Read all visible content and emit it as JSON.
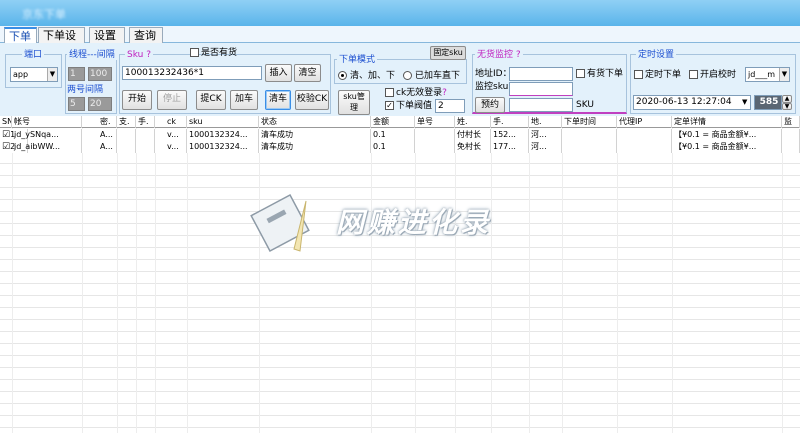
{
  "window": {
    "title": "京东下单"
  },
  "tabs": [
    "下单",
    "下单设置",
    "设置",
    "查询"
  ],
  "port_group": {
    "title": "端口",
    "value": "app"
  },
  "thread_group": {
    "title": "线程---间隔",
    "threads": "1",
    "interval": "100",
    "title2": "两号间隔",
    "v1": "5",
    "v2": "20"
  },
  "sku_group": {
    "title": "Sku",
    "help": "?",
    "in_stock_label": "是否有货",
    "sku_value": "100013232436*1",
    "insert_label": "插入",
    "clear_label": "清空"
  },
  "actions": {
    "start": "开始",
    "stop": "停止",
    "extract_ck": "提CK",
    "add_cart": "加车",
    "clear_cart": "清车",
    "verify_ck": "校验CK",
    "sku_manage": "sku管\n理"
  },
  "mode_group": {
    "title": "下单模式",
    "option1": "清、加、下",
    "option2": "已加车直下",
    "ck_invalid_login": "ck无效登录",
    "help": "?",
    "threshold_label": "下单阀值",
    "threshold_value": "2",
    "lock_sku": "固定sku"
  },
  "stock_group": {
    "title": "无货监控",
    "help": "?",
    "address_label": "地址ID：",
    "address_value": "",
    "stock_order_label": "有货下单",
    "monitor_label": "监控sku",
    "monitor_value": "",
    "reserve_label": "预约",
    "sku_label": "SKU"
  },
  "timer_group": {
    "title": "定时设置",
    "timed_order_label": "定时下单",
    "auto_start_label": "开启校时",
    "time_select_value": "jd___m",
    "datetime_value": "2020-06-13 12:27:04",
    "counter_value": "585"
  },
  "table": {
    "columns": [
      "SN",
      "帐号",
      "密.",
      "支.",
      "手.",
      "ck",
      "sku",
      "状态",
      "金额",
      "单号",
      "姓.",
      "手.",
      "地.",
      "下单时间",
      "代理IP",
      "定单详情",
      "监"
    ],
    "rows": [
      {
        "checked": true,
        "cells": [
          "1",
          "jd_ySNqa...",
          "A...",
          "",
          "",
          "v...",
          "1000132324...",
          "清车成功",
          "0.1",
          "",
          "付村长",
          "152...",
          "河...",
          "",
          "",
          "【¥0.1 = 商品金额¥...",
          ""
        ]
      },
      {
        "checked": true,
        "cells": [
          "2",
          "jd_aibWW...",
          "A...",
          "",
          "",
          "v...",
          "1000132324...",
          "清车成功",
          "0.1",
          "",
          "免村长",
          "177...",
          "河...",
          "",
          "",
          "【¥0.1 = 商品金额¥...",
          ""
        ]
      }
    ]
  },
  "watermark": {
    "text": "网赚进化录"
  }
}
